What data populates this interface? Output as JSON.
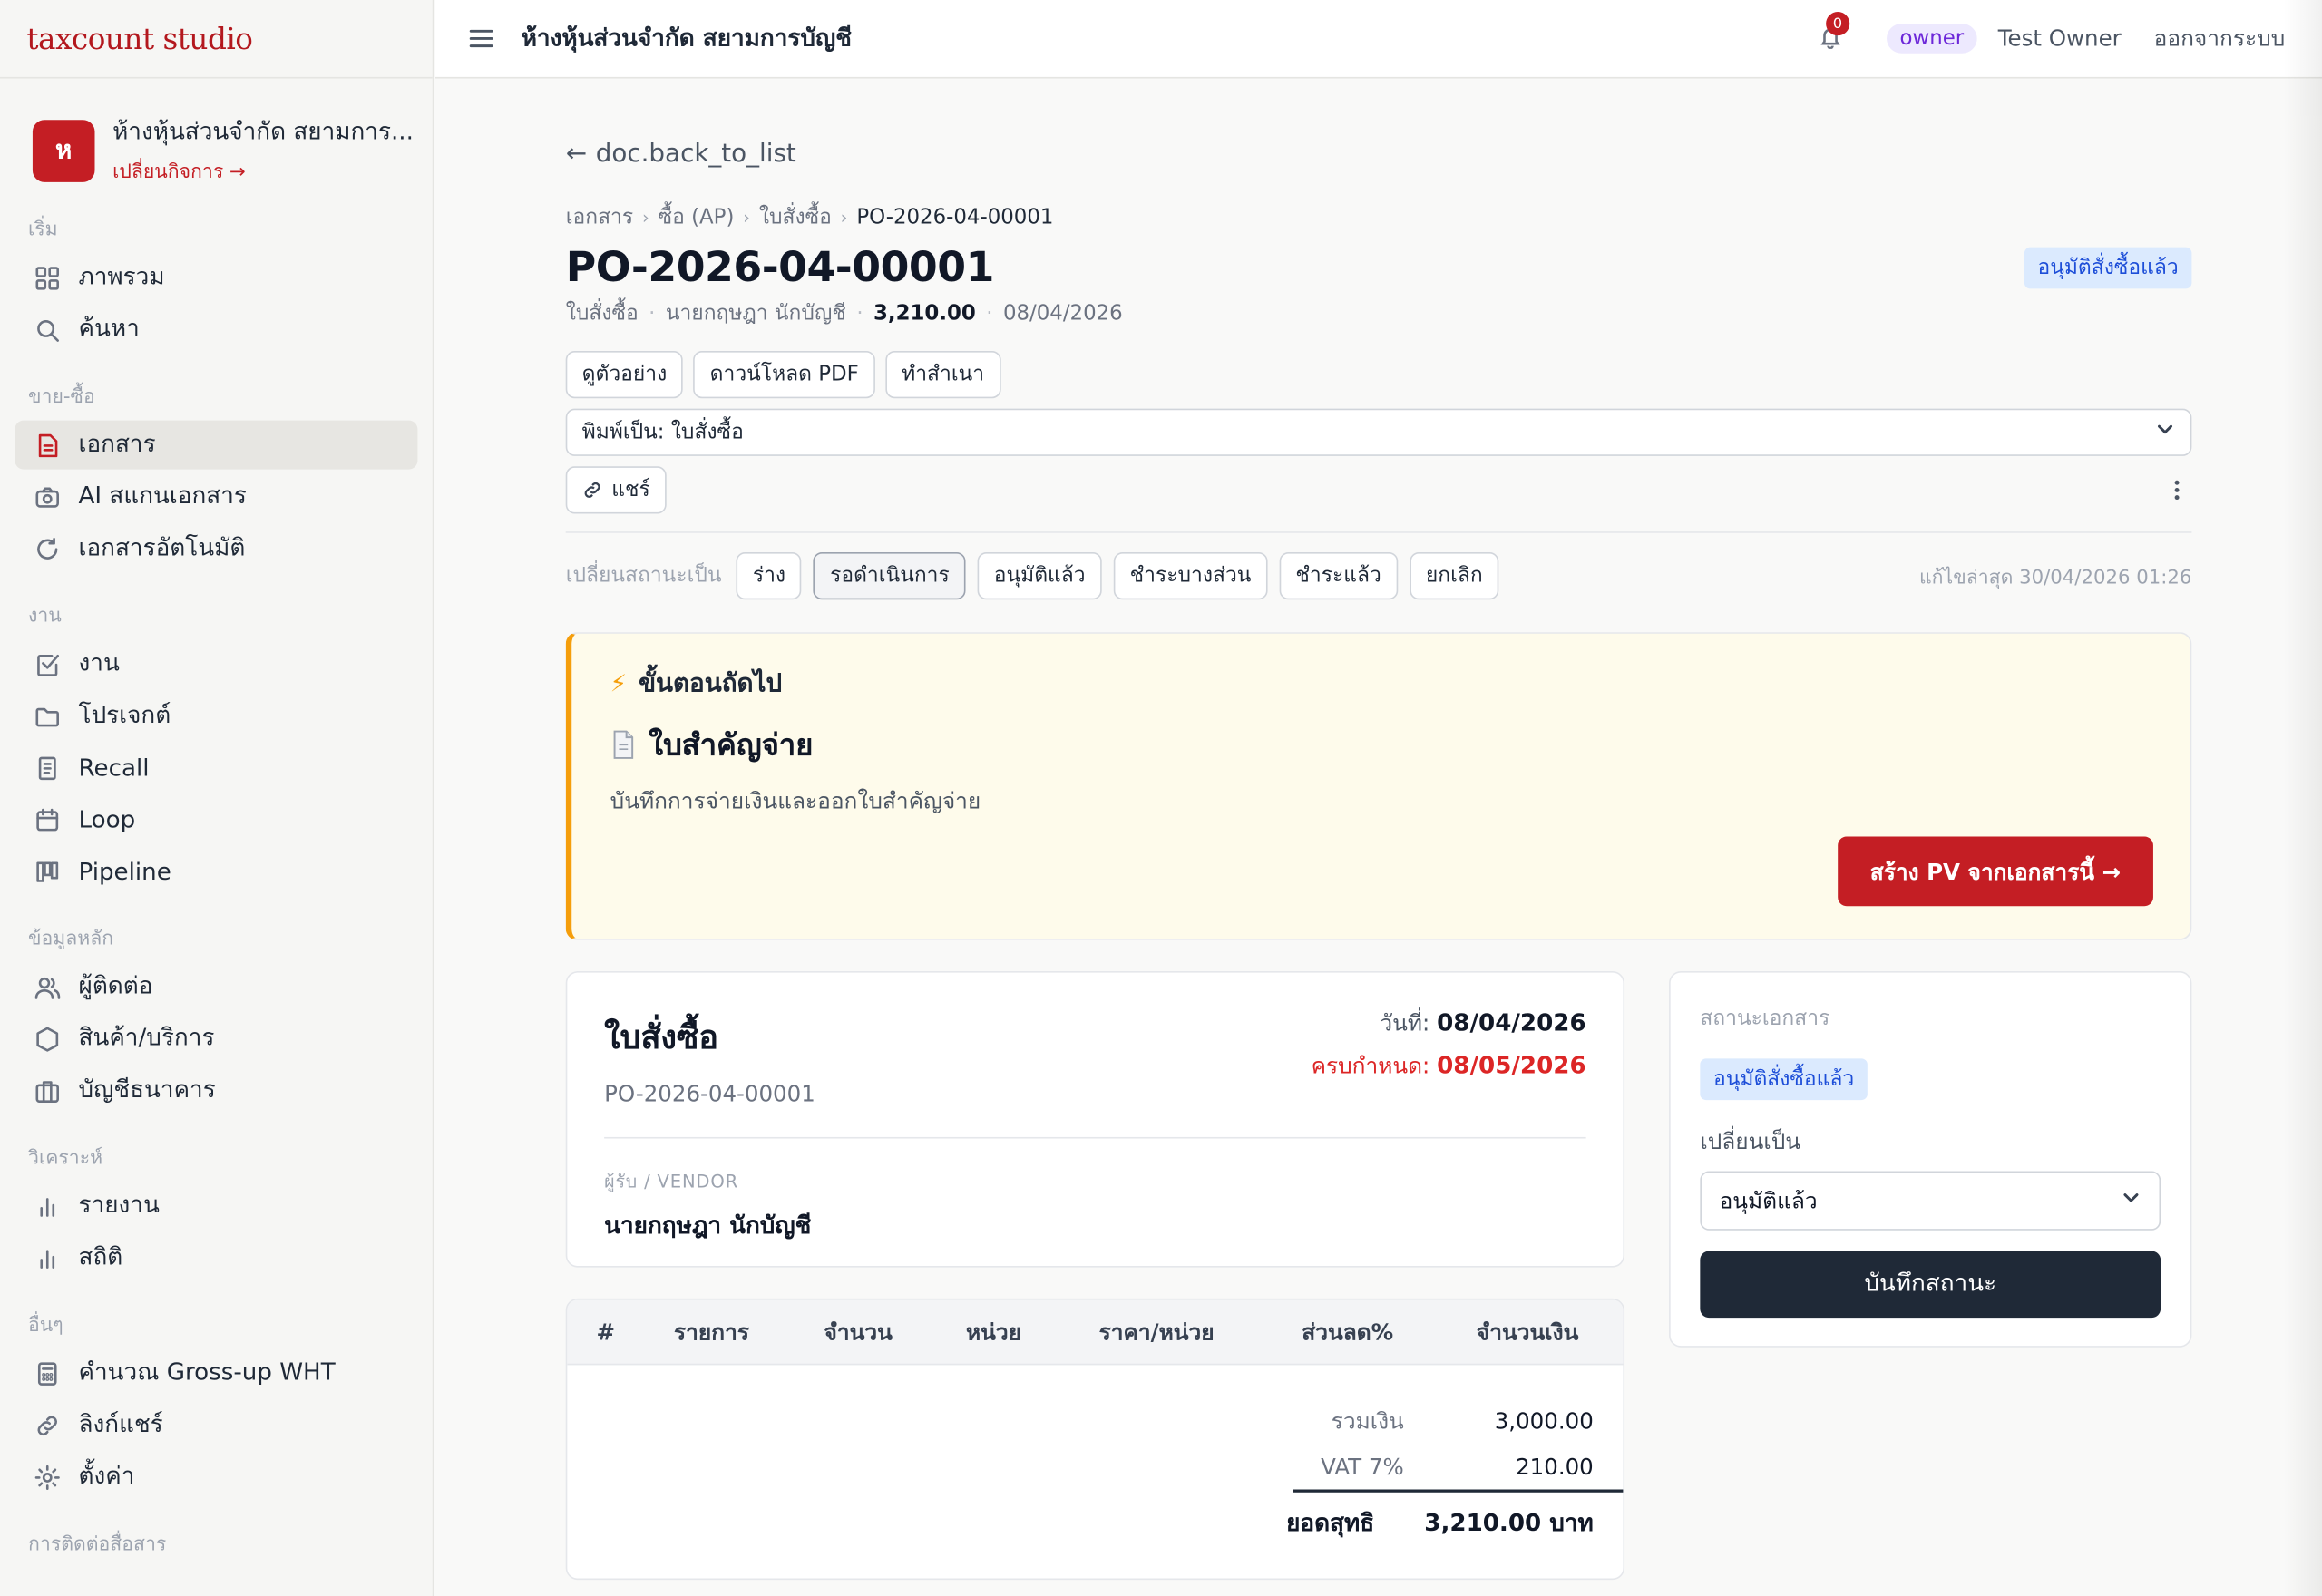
{
  "brand": {
    "name": "taxcount studio",
    "color": "#b3181e"
  },
  "business": {
    "avatar_letter": "ห",
    "name": "ห้างหุ้นส่วนจำกัด สยามการ...",
    "switch_label": "เปลี่ยนกิจการ →"
  },
  "sidebar": {
    "sections": [
      {
        "label": "เริ่ม",
        "items": [
          {
            "label": "ภาพรวม",
            "icon": "grid-icon"
          },
          {
            "label": "ค้นหา",
            "icon": "search-icon"
          }
        ]
      },
      {
        "label": "ขาย-ซื้อ",
        "items": [
          {
            "label": "เอกสาร",
            "icon": "document-icon",
            "active": true
          },
          {
            "label": "AI สแกนเอกสาร",
            "icon": "camera-icon"
          },
          {
            "label": "เอกสารอัตโนมัติ",
            "icon": "refresh-icon"
          }
        ]
      },
      {
        "label": "งาน",
        "items": [
          {
            "label": "งาน",
            "icon": "checkbox-icon"
          },
          {
            "label": "โปรเจกต์",
            "icon": "folder-icon"
          },
          {
            "label": "Recall",
            "icon": "receipt-icon"
          },
          {
            "label": "Loop",
            "icon": "calendar-icon"
          },
          {
            "label": "Pipeline",
            "icon": "kanban-icon"
          }
        ]
      },
      {
        "label": "ข้อมูลหลัก",
        "items": [
          {
            "label": "ผู้ติดต่อ",
            "icon": "users-icon"
          },
          {
            "label": "สินค้า/บริการ",
            "icon": "hexagon-icon"
          },
          {
            "label": "บัญชีธนาคาร",
            "icon": "briefcase-icon"
          }
        ]
      },
      {
        "label": "วิเคราะห์",
        "items": [
          {
            "label": "รายงาน",
            "icon": "bar-chart-icon"
          },
          {
            "label": "สถิติ",
            "icon": "bar-chart-icon"
          }
        ]
      },
      {
        "label": "อื่นๆ",
        "items": [
          {
            "label": "คำนวณ Gross-up WHT",
            "icon": "calculator-icon"
          },
          {
            "label": "ลิงก์แชร์",
            "icon": "link-icon"
          },
          {
            "label": "ตั้งค่า",
            "icon": "gear-icon"
          }
        ]
      },
      {
        "label": "การติดต่อสื่อสาร",
        "items": []
      }
    ]
  },
  "topbar": {
    "title": "ห้างหุ้นส่วนจำกัด สยามการบัญชี",
    "notif_count": "0",
    "role": "owner",
    "user": "Test Owner",
    "logout": "ออกจากระบบ"
  },
  "doc": {
    "back_label": "doc.back_to_list",
    "breadcrumb": [
      "เอกสาร",
      "ซื้อ (AP)",
      "ใบสั่งซื้อ",
      "PO-2026-04-00001"
    ],
    "number": "PO-2026-04-00001",
    "status_badge": "อนุมัติสั่งซื้อแล้ว",
    "meta": {
      "type": "ใบสั่งซื้อ",
      "contact": "นายกฤษฎา นักบัญชี",
      "amount": "3,210.00",
      "date": "08/04/2026"
    },
    "actions": {
      "preview": "ดูตัวอย่าง",
      "download": "ดาวน์โหลด PDF",
      "duplicate": "ทำสำเนา"
    },
    "print_as": "พิมพ์เป็น: ใบสั่งซื้อ",
    "share": "แชร์",
    "status_change": {
      "label": "เปลี่ยนสถานะเป็น",
      "options": [
        "ร่าง",
        "รอดำเนินการ",
        "อนุมัติแล้ว",
        "ชำระบางส่วน",
        "ชำระแล้ว",
        "ยกเลิก"
      ],
      "current": "รอดำเนินการ"
    },
    "last_edit": "แก้ไขล่าสุด 30/04/2026 01:26"
  },
  "next_step": {
    "heading": "ขั้นตอนถัดไป",
    "title": "ใบสำคัญจ่าย",
    "description": "บันทึกการจ่ายเงินและออกใบสำคัญจ่าย",
    "cta": "สร้าง PV จากเอกสารนี้ →"
  },
  "doc_card": {
    "title": "ใบสั่งซื้อ",
    "number": "PO-2026-04-00001",
    "date_label": "วันที่:",
    "date": "08/04/2026",
    "due_label": "ครบกำหนด:",
    "due": "08/05/2026",
    "vendor_label": "ผู้รับ / VENDOR",
    "vendor_name": "นายกฤษฎา นักบัญชี"
  },
  "items_table": {
    "columns": [
      "#",
      "รายการ",
      "จำนวน",
      "หน่วย",
      "ราคา/หน่วย",
      "ส่วนลด%",
      "จำนวนเงิน"
    ],
    "rows": [],
    "subtotal_label": "รวมเงิน",
    "subtotal": "3,000.00",
    "vat_label": "VAT 7%",
    "vat": "210.00",
    "net_label": "ยอดสุทธิ",
    "net": "3,210.00 บาท"
  },
  "status_card": {
    "label": "สถานะเอกสาร",
    "badge": "อนุมัติสั่งซื้อแล้ว",
    "change_label": "เปลี่ยนเป็น",
    "selected": "อนุมัติแล้ว",
    "save": "บันทึกสถานะ"
  },
  "colors": {
    "accent": "#c41e24",
    "badge_bg": "#dbeafe",
    "badge_fg": "#1d4ed8",
    "next_bg": "#fefbeb",
    "next_border": "#f59e0b",
    "dark": "#1f2937"
  }
}
